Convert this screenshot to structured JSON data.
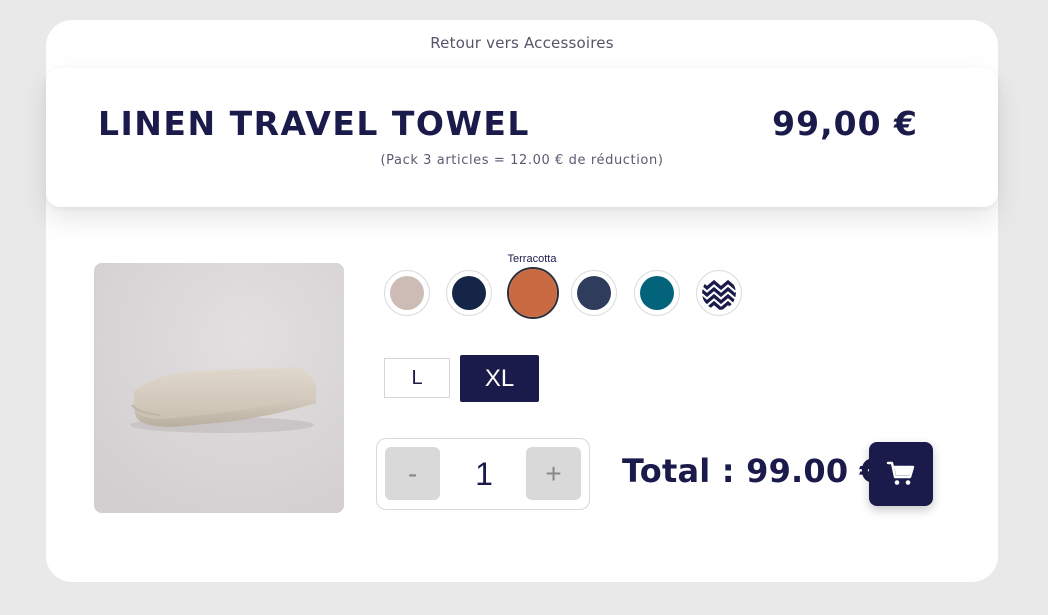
{
  "nav": {
    "back_label": "Retour vers Accessoires"
  },
  "product": {
    "title": "LINEN TRAVEL TOWEL",
    "price": "99,00 €",
    "pack_note": "(Pack 3 articles = 12.00 € de réduction)",
    "image_icon": "folded-towel-photo"
  },
  "colors": {
    "selected_label": "Terracotta",
    "options": [
      {
        "name": "beige",
        "hex": "#cdbcb6"
      },
      {
        "name": "navy",
        "hex": "#142548"
      },
      {
        "name": "terracotta",
        "hex": "#c96a43"
      },
      {
        "name": "slate",
        "hex": "#2f3c5b"
      },
      {
        "name": "teal",
        "hex": "#02637a"
      },
      {
        "name": "chevron",
        "hex": "#1b1b4b"
      }
    ]
  },
  "sizes": {
    "options": [
      "L",
      "XL"
    ],
    "selected": "XL"
  },
  "quantity": {
    "minus_label": "-",
    "value": "1",
    "plus_label": "+"
  },
  "total": {
    "text": "Total : 99.00 €"
  },
  "cart": {
    "icon": "cart-icon"
  },
  "theme": {
    "accent": "#1b1b4b",
    "background": "#e9e9e9"
  }
}
